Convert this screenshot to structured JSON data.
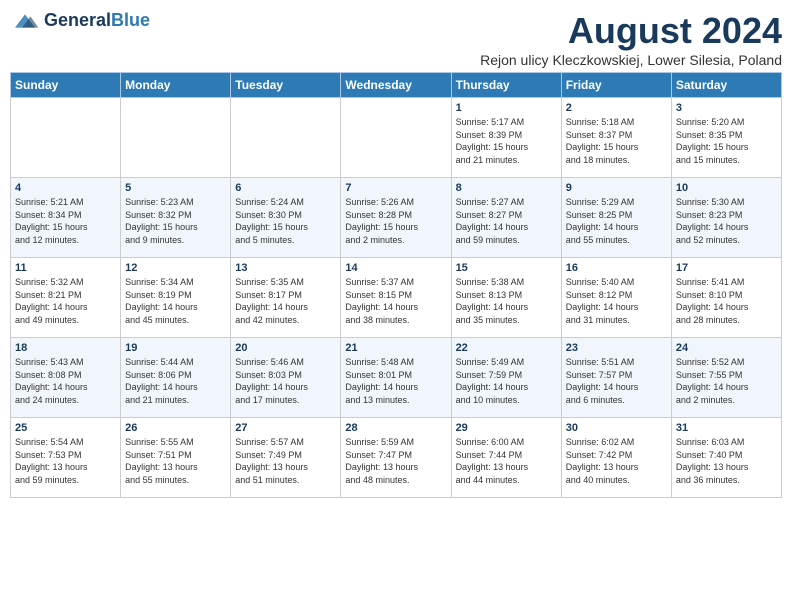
{
  "header": {
    "logo_general": "General",
    "logo_blue": "Blue",
    "title": "August 2024",
    "subtitle": "Rejon ulicy Kleczkowskiej, Lower Silesia, Poland"
  },
  "days_of_week": [
    "Sunday",
    "Monday",
    "Tuesday",
    "Wednesday",
    "Thursday",
    "Friday",
    "Saturday"
  ],
  "weeks": [
    [
      {
        "day": "",
        "info": ""
      },
      {
        "day": "",
        "info": ""
      },
      {
        "day": "",
        "info": ""
      },
      {
        "day": "",
        "info": ""
      },
      {
        "day": "1",
        "info": "Sunrise: 5:17 AM\nSunset: 8:39 PM\nDaylight: 15 hours\nand 21 minutes."
      },
      {
        "day": "2",
        "info": "Sunrise: 5:18 AM\nSunset: 8:37 PM\nDaylight: 15 hours\nand 18 minutes."
      },
      {
        "day": "3",
        "info": "Sunrise: 5:20 AM\nSunset: 8:35 PM\nDaylight: 15 hours\nand 15 minutes."
      }
    ],
    [
      {
        "day": "4",
        "info": "Sunrise: 5:21 AM\nSunset: 8:34 PM\nDaylight: 15 hours\nand 12 minutes."
      },
      {
        "day": "5",
        "info": "Sunrise: 5:23 AM\nSunset: 8:32 PM\nDaylight: 15 hours\nand 9 minutes."
      },
      {
        "day": "6",
        "info": "Sunrise: 5:24 AM\nSunset: 8:30 PM\nDaylight: 15 hours\nand 5 minutes."
      },
      {
        "day": "7",
        "info": "Sunrise: 5:26 AM\nSunset: 8:28 PM\nDaylight: 15 hours\nand 2 minutes."
      },
      {
        "day": "8",
        "info": "Sunrise: 5:27 AM\nSunset: 8:27 PM\nDaylight: 14 hours\nand 59 minutes."
      },
      {
        "day": "9",
        "info": "Sunrise: 5:29 AM\nSunset: 8:25 PM\nDaylight: 14 hours\nand 55 minutes."
      },
      {
        "day": "10",
        "info": "Sunrise: 5:30 AM\nSunset: 8:23 PM\nDaylight: 14 hours\nand 52 minutes."
      }
    ],
    [
      {
        "day": "11",
        "info": "Sunrise: 5:32 AM\nSunset: 8:21 PM\nDaylight: 14 hours\nand 49 minutes."
      },
      {
        "day": "12",
        "info": "Sunrise: 5:34 AM\nSunset: 8:19 PM\nDaylight: 14 hours\nand 45 minutes."
      },
      {
        "day": "13",
        "info": "Sunrise: 5:35 AM\nSunset: 8:17 PM\nDaylight: 14 hours\nand 42 minutes."
      },
      {
        "day": "14",
        "info": "Sunrise: 5:37 AM\nSunset: 8:15 PM\nDaylight: 14 hours\nand 38 minutes."
      },
      {
        "day": "15",
        "info": "Sunrise: 5:38 AM\nSunset: 8:13 PM\nDaylight: 14 hours\nand 35 minutes."
      },
      {
        "day": "16",
        "info": "Sunrise: 5:40 AM\nSunset: 8:12 PM\nDaylight: 14 hours\nand 31 minutes."
      },
      {
        "day": "17",
        "info": "Sunrise: 5:41 AM\nSunset: 8:10 PM\nDaylight: 14 hours\nand 28 minutes."
      }
    ],
    [
      {
        "day": "18",
        "info": "Sunrise: 5:43 AM\nSunset: 8:08 PM\nDaylight: 14 hours\nand 24 minutes."
      },
      {
        "day": "19",
        "info": "Sunrise: 5:44 AM\nSunset: 8:06 PM\nDaylight: 14 hours\nand 21 minutes."
      },
      {
        "day": "20",
        "info": "Sunrise: 5:46 AM\nSunset: 8:03 PM\nDaylight: 14 hours\nand 17 minutes."
      },
      {
        "day": "21",
        "info": "Sunrise: 5:48 AM\nSunset: 8:01 PM\nDaylight: 14 hours\nand 13 minutes."
      },
      {
        "day": "22",
        "info": "Sunrise: 5:49 AM\nSunset: 7:59 PM\nDaylight: 14 hours\nand 10 minutes."
      },
      {
        "day": "23",
        "info": "Sunrise: 5:51 AM\nSunset: 7:57 PM\nDaylight: 14 hours\nand 6 minutes."
      },
      {
        "day": "24",
        "info": "Sunrise: 5:52 AM\nSunset: 7:55 PM\nDaylight: 14 hours\nand 2 minutes."
      }
    ],
    [
      {
        "day": "25",
        "info": "Sunrise: 5:54 AM\nSunset: 7:53 PM\nDaylight: 13 hours\nand 59 minutes."
      },
      {
        "day": "26",
        "info": "Sunrise: 5:55 AM\nSunset: 7:51 PM\nDaylight: 13 hours\nand 55 minutes."
      },
      {
        "day": "27",
        "info": "Sunrise: 5:57 AM\nSunset: 7:49 PM\nDaylight: 13 hours\nand 51 minutes."
      },
      {
        "day": "28",
        "info": "Sunrise: 5:59 AM\nSunset: 7:47 PM\nDaylight: 13 hours\nand 48 minutes."
      },
      {
        "day": "29",
        "info": "Sunrise: 6:00 AM\nSunset: 7:44 PM\nDaylight: 13 hours\nand 44 minutes."
      },
      {
        "day": "30",
        "info": "Sunrise: 6:02 AM\nSunset: 7:42 PM\nDaylight: 13 hours\nand 40 minutes."
      },
      {
        "day": "31",
        "info": "Sunrise: 6:03 AM\nSunset: 7:40 PM\nDaylight: 13 hours\nand 36 minutes."
      }
    ]
  ]
}
